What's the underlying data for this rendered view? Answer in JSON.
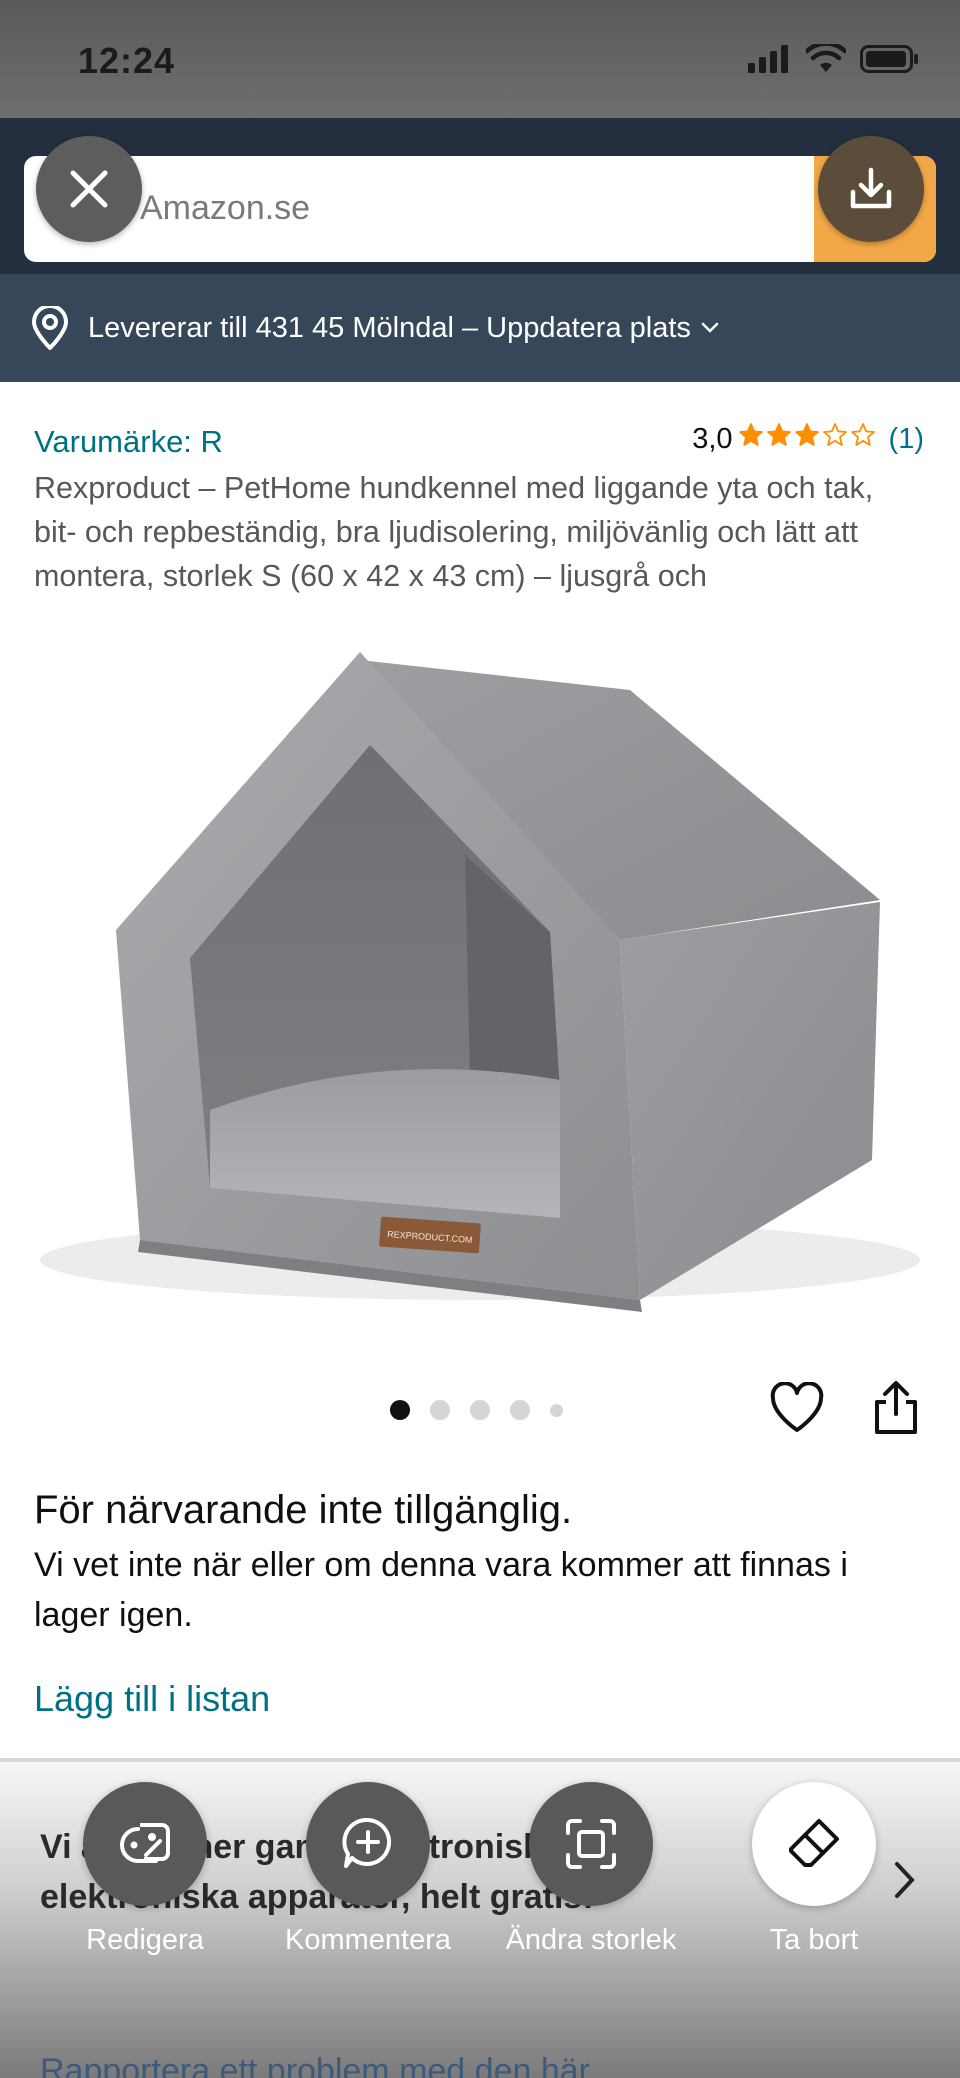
{
  "status_bar": {
    "time": "12:24"
  },
  "search": {
    "placeholder": "Amazon.se"
  },
  "delivery": {
    "text": "Levererar till 431 45 Mölndal – Uppdatera plats"
  },
  "product": {
    "brand": "Varumärke: R",
    "rating_value": "3,0",
    "rating_stars": 3,
    "rating_count": "(1)",
    "title": "Rexproduct – PetHome hundkennel med liggande yta och tak, bit- och repbeständig, bra ljudisolering, miljövänlig och lätt att montera, storlek S (60 x 42 x 43 cm) – ljusgrå och",
    "tag_text": "REXPRODUCT.COM",
    "image_count": 5,
    "image_index": 1
  },
  "availability": {
    "heading": "För närvarande inte tillgänglig.",
    "message": "Vi vet inte när eller om denna vara kommer att finnas i lager igen."
  },
  "add_to_list": "Lägg till i listan",
  "promo": {
    "text": "Vi återvinner gamla elektroniska eller elektroniska apparater, helt gratis:"
  },
  "report": {
    "text": "Rapportera ett problem med den här"
  },
  "toolbar": {
    "edit": "Redigera",
    "comment": "Kommentera",
    "resize": "Ändra storlek",
    "remove": "Ta bort"
  },
  "colors": {
    "header": "#232f3e",
    "delivery_bar": "#37475a",
    "link": "#007185",
    "star": "#ff8f00",
    "search_button": "#f3a847"
  }
}
